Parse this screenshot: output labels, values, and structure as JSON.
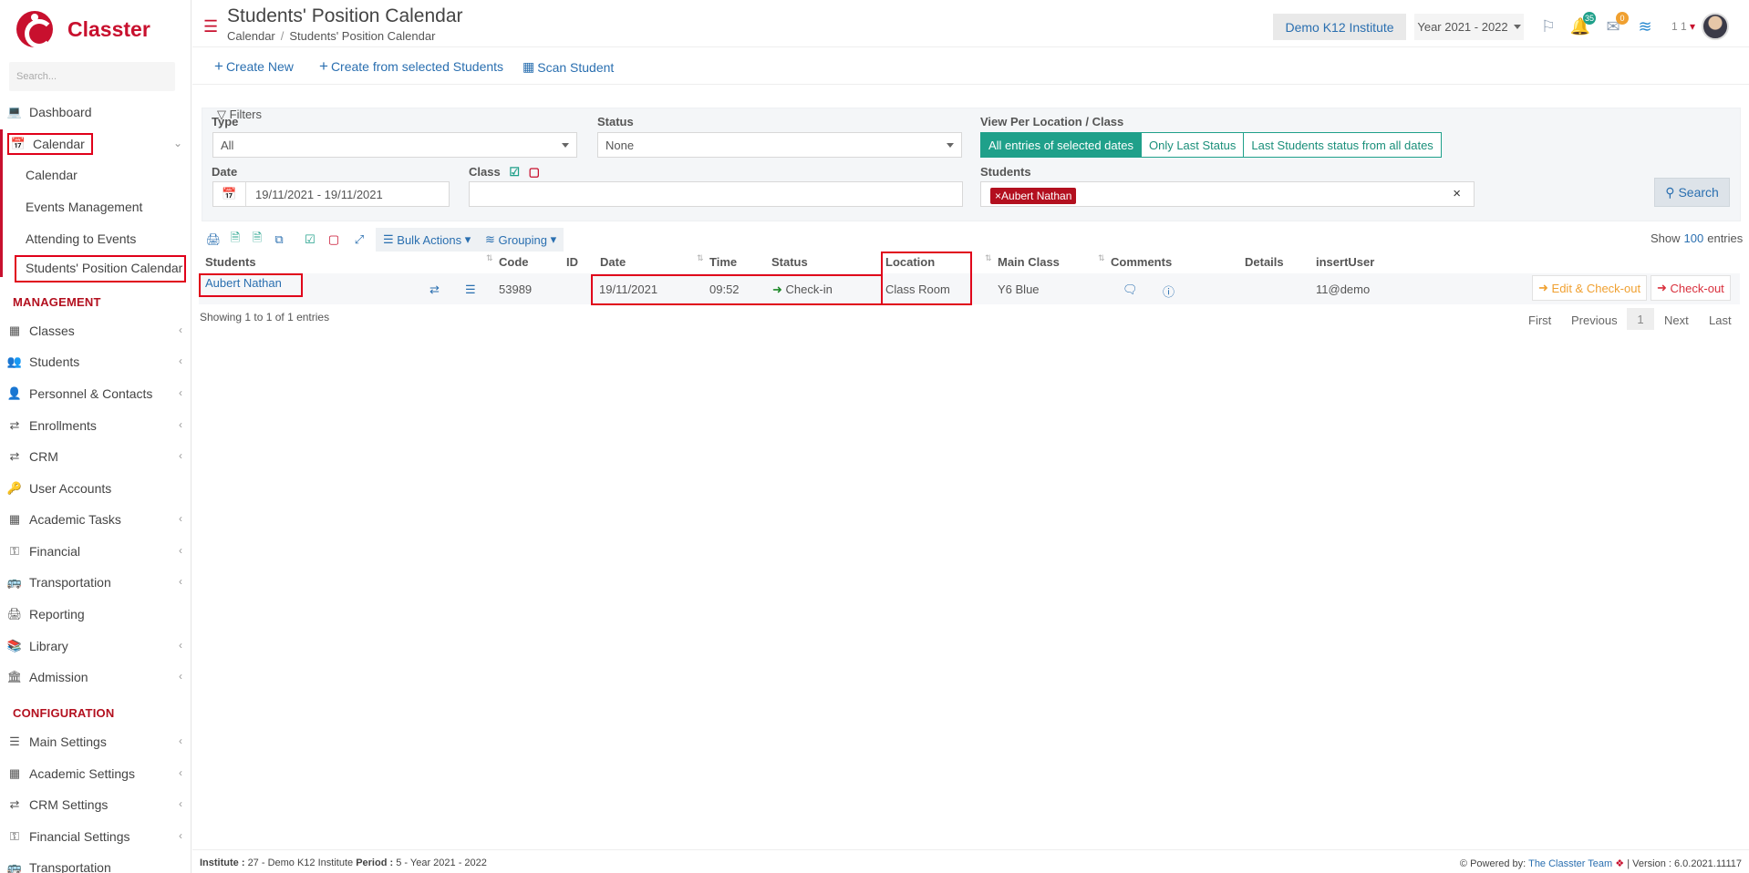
{
  "app": {
    "brand": "Classter",
    "brand_color": "#c8102e",
    "accent": "#2a6fb0"
  },
  "sidebar": {
    "search_placeholder": "Search...",
    "items_top": [
      {
        "label": "Dashboard",
        "icon": "laptop-icon"
      },
      {
        "label": "Calendar",
        "icon": "calendar-icon"
      }
    ],
    "calendar_sub": [
      "Calendar",
      "Events Management",
      "Attending to Events",
      "Students' Position Calendar"
    ],
    "management_title": "MANAGEMENT",
    "management": [
      {
        "label": "Classes",
        "icon": "classes-icon"
      },
      {
        "label": "Students",
        "icon": "users-icon"
      },
      {
        "label": "Personnel & Contacts",
        "icon": "person-icon"
      },
      {
        "label": "Enrollments",
        "icon": "exchange-icon"
      },
      {
        "label": "CRM",
        "icon": "shuffle-icon"
      },
      {
        "label": "User Accounts",
        "icon": "key-icon"
      },
      {
        "label": "Academic Tasks",
        "icon": "grid-icon"
      },
      {
        "label": "Financial",
        "icon": "coins-icon"
      },
      {
        "label": "Transportation",
        "icon": "bus-icon"
      },
      {
        "label": "Reporting",
        "icon": "print-icon"
      },
      {
        "label": "Library",
        "icon": "books-icon"
      },
      {
        "label": "Admission",
        "icon": "bank-icon"
      }
    ],
    "configuration_title": "CONFIGURATION",
    "configuration": [
      {
        "label": "Main Settings",
        "icon": "sliders-icon"
      },
      {
        "label": "Academic Settings",
        "icon": "classes-icon"
      },
      {
        "label": "CRM Settings",
        "icon": "shuffle-icon"
      },
      {
        "label": "Financial Settings",
        "icon": "coins-icon"
      },
      {
        "label": "Transportation",
        "icon": "bus-icon"
      }
    ]
  },
  "header": {
    "title": "Students' Position Calendar",
    "breadcrumb": [
      "Calendar",
      "Students' Position Calendar"
    ],
    "institute": "Demo K12 Institute",
    "year": "Year 2021 - 2022",
    "notifications_count": "35",
    "messages_count": "0",
    "user_short": "1 1"
  },
  "toolbar": {
    "create_new": "Create New",
    "create_from_selected": "Create from selected Students",
    "scan_student": "Scan Student"
  },
  "filters": {
    "legend": "Filters",
    "type_label": "Type",
    "type_value": "All",
    "status_label": "Status",
    "status_value": "None",
    "view_label": "View Per Location / Class",
    "view_options": [
      "All entries of selected dates",
      "Only Last Status",
      "Last Students status from all dates"
    ],
    "view_selected": "All entries of selected dates",
    "date_label": "Date",
    "date_value": "19/11/2021 - 19/11/2021",
    "class_label": "Class",
    "students_label": "Students",
    "students_selected": [
      "Aubert Nathan"
    ],
    "search_button": "Search"
  },
  "table_toolbar": {
    "bulk_actions": "Bulk Actions",
    "grouping": "Grouping",
    "show_label": "Show",
    "show_count": "100",
    "entries_label": "entries"
  },
  "table": {
    "columns": [
      "Students",
      "Code",
      "ID",
      "Date",
      "Time",
      "Status",
      "Location",
      "Main Class",
      "Comments",
      "Details",
      "insertUser"
    ],
    "rows": [
      {
        "student": "Aubert Nathan",
        "code": "53989",
        "id": "",
        "date": "19/11/2021",
        "time": "09:52",
        "status": "Check-in",
        "location": "Class Room",
        "main_class": "Y6 Blue",
        "details": "",
        "insert_user": "11@demo",
        "edit_checkout": "Edit & Check-out",
        "checkout": "Check-out"
      }
    ],
    "showing": "Showing 1 to 1 of 1 entries",
    "pagination": {
      "first": "First",
      "previous": "Previous",
      "current": "1",
      "next": "Next",
      "last": "Last"
    }
  },
  "footer": {
    "institute_label": "Institute :",
    "institute_value": "27 - Demo K12 Institute",
    "period_label": "Period :",
    "period_value": "5 - Year 2021 - 2022",
    "powered_by": "Powered by:",
    "powered_team": "The Classter Team",
    "version": "| Version : 6.0.2021.11117"
  }
}
